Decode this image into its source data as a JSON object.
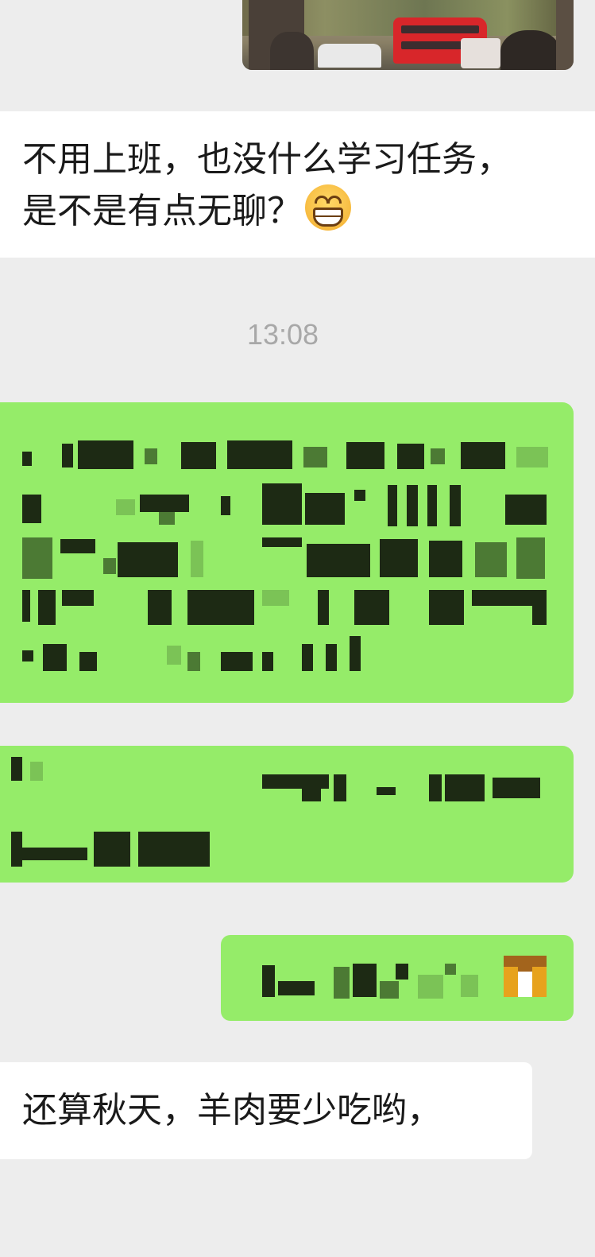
{
  "chat": {
    "messages": [
      {
        "type": "image",
        "description_icon": "photo-thumbnail"
      },
      {
        "type": "text",
        "line1": "不用上班，也没什么学习任务，",
        "line2": "是不是有点无聊？",
        "emoji": "grin-emoji"
      },
      {
        "type": "timestamp",
        "text": "13:08"
      },
      {
        "type": "redacted"
      },
      {
        "type": "redacted"
      },
      {
        "type": "redacted"
      },
      {
        "type": "text",
        "text": "还算秋天，羊肉要少吃哟，"
      }
    ]
  },
  "colors": {
    "background": "#ededed",
    "bubble_outgoing": "#95ec69",
    "bubble_incoming": "#ffffff",
    "timestamp": "#a8a8a8",
    "text": "#1a1a1a"
  }
}
